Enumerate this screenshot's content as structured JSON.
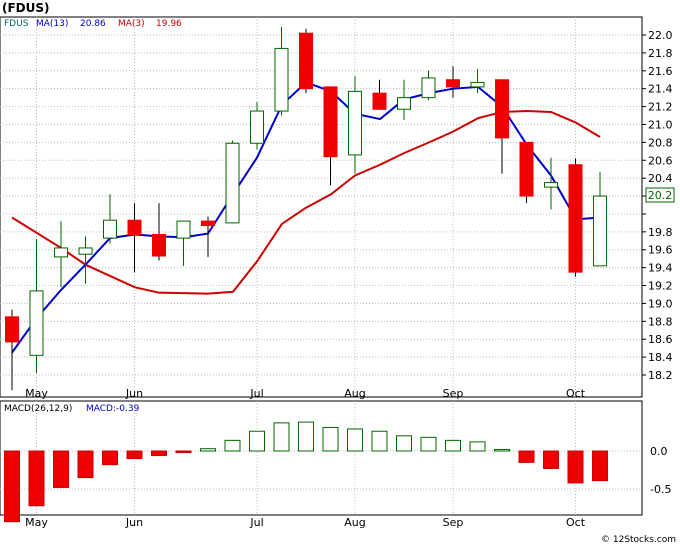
{
  "chart_data": [
    {
      "type": "candlestick",
      "title": "(FDUS)",
      "legend": [
        {
          "label": "FDUS",
          "color": "#006666"
        },
        {
          "label": "MA(13)",
          "color": "#0000cc"
        },
        {
          "label": "20.86",
          "color": "#0000cc"
        },
        {
          "label": "MA(3)",
          "color": "#cc0000"
        },
        {
          "label": "19.96",
          "color": "#cc0000"
        }
      ],
      "ylim": [
        18.0,
        22.2
      ],
      "yticks": [
        18.2,
        18.4,
        18.6,
        18.8,
        19.0,
        19.2,
        19.4,
        19.6,
        19.8,
        20.0,
        20.2,
        20.4,
        20.6,
        20.8,
        21.0,
        21.2,
        21.4,
        21.6,
        21.8,
        22.0
      ],
      "ytick_labels": [
        "18.2",
        "18.4",
        "18.6",
        "18.8",
        "19.0",
        "19.2",
        "19.4",
        "19.6",
        "19.8",
        "",
        "",
        "20.4",
        "20.6",
        "20.8",
        "21.0",
        "21.2",
        "21.4",
        "21.6",
        "21.8",
        "22.0"
      ],
      "last_price": "20.2",
      "x_labels": [
        {
          "label": "May",
          "index": 1
        },
        {
          "label": "Jun",
          "index": 5
        },
        {
          "label": "Jul",
          "index": 10
        },
        {
          "label": "Aug",
          "index": 14
        },
        {
          "label": "Sep",
          "index": 18
        },
        {
          "label": "Oct",
          "index": 23
        }
      ],
      "candles": [
        {
          "o": 18.57,
          "h": 18.66,
          "l": 18.03,
          "c": 18.85,
          "up": false,
          "filled": true,
          "hi": 18.93,
          "lo": 18.03
        },
        {
          "o": 18.42,
          "h": 19.72,
          "l": 18.22,
          "c": 19.14,
          "up": true
        },
        {
          "o": 19.52,
          "h": 19.92,
          "l": 19.18,
          "c": 19.62,
          "up": true
        },
        {
          "o": 19.55,
          "h": 19.75,
          "l": 19.22,
          "c": 19.62,
          "up": true
        },
        {
          "o": 19.73,
          "h": 20.22,
          "l": 19.67,
          "c": 19.93,
          "up": true
        },
        {
          "o": 19.93,
          "h": 20.12,
          "l": 19.35,
          "c": 19.77,
          "up": false
        },
        {
          "o": 19.77,
          "h": 20.12,
          "l": 19.48,
          "c": 19.53,
          "up": false
        },
        {
          "o": 19.73,
          "h": 19.92,
          "l": 19.42,
          "c": 19.92,
          "up": true
        },
        {
          "o": 19.92,
          "h": 19.97,
          "l": 19.52,
          "c": 19.87,
          "up": false
        },
        {
          "o": 19.9,
          "h": 20.82,
          "l": 19.9,
          "c": 20.79,
          "up": true
        },
        {
          "o": 20.79,
          "h": 21.25,
          "l": 20.72,
          "c": 21.15,
          "up": true
        },
        {
          "o": 21.15,
          "h": 22.09,
          "l": 21.1,
          "c": 21.85,
          "up": true
        },
        {
          "o": 22.02,
          "h": 22.07,
          "l": 21.35,
          "c": 21.4,
          "up": false
        },
        {
          "o": 21.42,
          "h": 21.42,
          "l": 20.32,
          "c": 20.64,
          "up": false
        },
        {
          "o": 20.66,
          "h": 21.54,
          "l": 20.45,
          "c": 21.37,
          "up": true
        },
        {
          "o": 21.35,
          "h": 21.5,
          "l": 21.17,
          "c": 21.17,
          "up": false
        },
        {
          "o": 21.17,
          "h": 21.5,
          "l": 21.05,
          "c": 21.3,
          "up": true
        },
        {
          "o": 21.3,
          "h": 21.6,
          "l": 21.27,
          "c": 21.52,
          "up": true
        },
        {
          "o": 21.5,
          "h": 21.65,
          "l": 21.3,
          "c": 21.42,
          "up": false
        },
        {
          "o": 21.42,
          "h": 21.62,
          "l": 21.35,
          "c": 21.47,
          "up": true
        },
        {
          "o": 21.5,
          "h": 21.5,
          "l": 20.45,
          "c": 20.85,
          "up": false
        },
        {
          "o": 20.8,
          "h": 20.8,
          "l": 20.12,
          "c": 20.2,
          "up": false
        },
        {
          "o": 20.3,
          "h": 20.63,
          "l": 20.05,
          "c": 20.35,
          "up": true
        },
        {
          "o": 20.55,
          "h": 20.62,
          "l": 19.3,
          "c": 19.35,
          "up": false
        },
        {
          "o": 19.42,
          "h": 20.47,
          "l": 19.42,
          "c": 20.2,
          "up": true
        }
      ],
      "series": [
        {
          "name": "MA(13)",
          "color": "#0000cc",
          "values": [
            18.45,
            18.85,
            19.15,
            19.45,
            19.72,
            19.76,
            19.76,
            19.74,
            19.77,
            20.2,
            20.6,
            21.25,
            21.47
          ]
        },
        {
          "name": "MA(3)",
          "color": "#cc0000",
          "values": [
            19.96,
            19.75,
            19.5,
            19.3,
            19.17,
            19.12,
            19.11,
            19.1,
            19.3,
            19.87,
            20.61,
            21.45,
            21.43
          ]
        }
      ],
      "ma13_tail": [
        21.47,
        21.37,
        21.1,
        21.06,
        21.15,
        21.16,
        21.14,
        21.12,
        21.1,
        21.14,
        20.85,
        20.2,
        19.96
      ],
      "ma3_tail": [
        21.43,
        21.3,
        21.14,
        21.12,
        21.15,
        21.18,
        21.12,
        21.1,
        21.06,
        21.04,
        20.97,
        20.92,
        20.86
      ]
    },
    {
      "type": "bar",
      "label": "MACD(26,12,9)",
      "legend": [
        {
          "label": "MACD(26,12,9)",
          "color": "#000000"
        },
        {
          "label": "MACD:-0.39",
          "color": "#0000cc"
        }
      ],
      "ylim": [
        -0.95,
        0.5
      ],
      "yticks": [
        0.0,
        -0.5
      ],
      "ytick_labels": [
        "0.0",
        "-0.5"
      ],
      "values": [
        -0.93,
        -0.72,
        -0.48,
        -0.35,
        -0.18,
        -0.1,
        -0.06,
        -0.02,
        0.03,
        0.14,
        0.26,
        0.37,
        0.38,
        0.31,
        0.29,
        0.26,
        0.2,
        0.18,
        0.14,
        0.12,
        0.02,
        -0.15,
        -0.23,
        -0.42,
        -0.39
      ]
    }
  ],
  "footer": "© 12Stocks.com"
}
